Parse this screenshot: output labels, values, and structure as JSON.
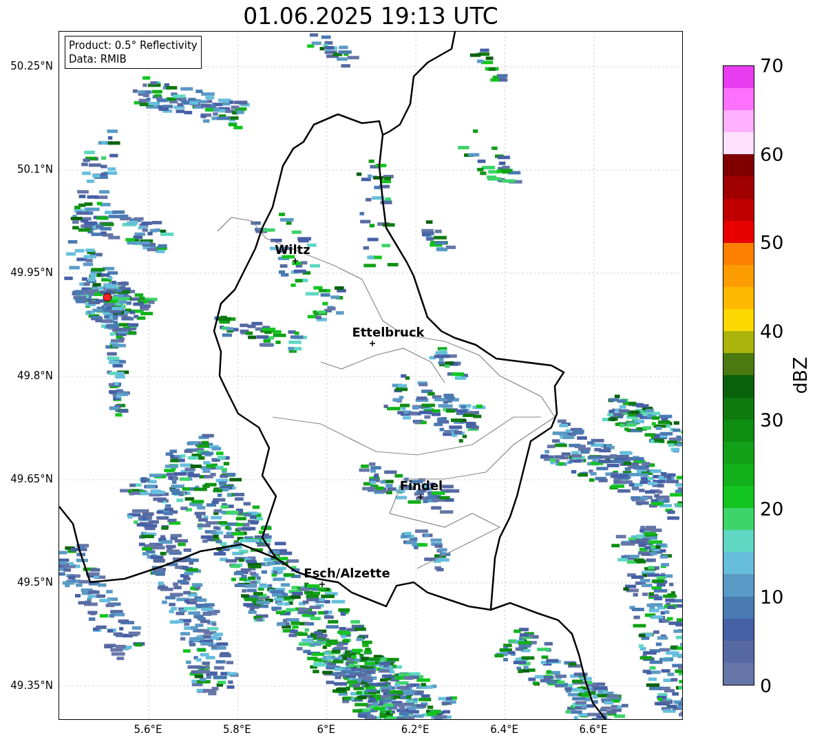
{
  "title": "01.06.2025 19:13 UTC",
  "legend": [
    "Product: 0.5° Reflectivity",
    "Data: RMIB"
  ],
  "map": {
    "y_ticks": [
      "50.25°N",
      "50.1°N",
      "49.95°N",
      "49.8°N",
      "49.65°N",
      "49.5°N",
      "49.35°N"
    ],
    "x_ticks": [
      "5.6°E",
      "5.8°E",
      "6°E",
      "6.2°E",
      "6.4°E",
      "6.6°E"
    ],
    "cities": [
      {
        "name": "Wiltz"
      },
      {
        "name": "Ettelbruck"
      },
      {
        "name": "Findel"
      },
      {
        "name": "Esch/Alzette"
      }
    ]
  },
  "colorbar": {
    "label": "dBZ",
    "ticks": [
      "70",
      "60",
      "50",
      "40",
      "30",
      "20",
      "10",
      "0"
    ],
    "segments": [
      {
        "color": "#6676a8"
      },
      {
        "color": "#5669a2"
      },
      {
        "color": "#4660a6"
      },
      {
        "color": "#4a7ab2"
      },
      {
        "color": "#5a9ac6"
      },
      {
        "color": "#66bedc"
      },
      {
        "color": "#5fd7c3"
      },
      {
        "color": "#3dd46a"
      },
      {
        "color": "#12c51e"
      },
      {
        "color": "#12b01a"
      },
      {
        "color": "#12a016"
      },
      {
        "color": "#0e8f12"
      },
      {
        "color": "#0e7a0e"
      },
      {
        "color": "#0a620c"
      },
      {
        "color": "#4a7a10"
      },
      {
        "color": "#aab40a"
      },
      {
        "color": "#fdd800"
      },
      {
        "color": "#fdb800"
      },
      {
        "color": "#fd9c00"
      },
      {
        "color": "#fd7f00"
      },
      {
        "color": "#e60000"
      },
      {
        "color": "#c00000"
      },
      {
        "color": "#a00000"
      },
      {
        "color": "#800000"
      },
      {
        "color": "#ffe0ff"
      },
      {
        "color": "#ffb0ff"
      },
      {
        "color": "#ff70ff"
      },
      {
        "color": "#e83cf0"
      }
    ]
  }
}
